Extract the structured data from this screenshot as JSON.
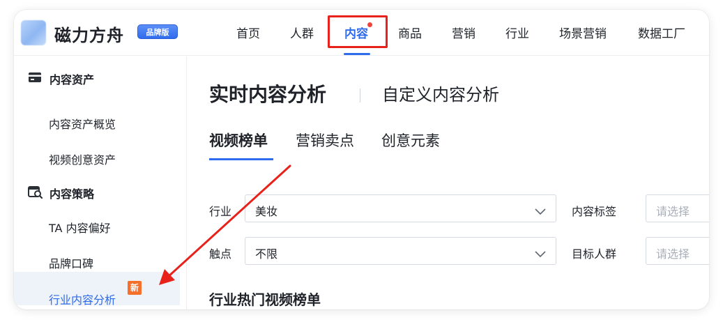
{
  "brand": {
    "name": "磁力方舟",
    "badge": "品牌版"
  },
  "nav": {
    "items": [
      {
        "label": "首页"
      },
      {
        "label": "人群"
      },
      {
        "label": "内容"
      },
      {
        "label": "商品"
      },
      {
        "label": "营销"
      },
      {
        "label": "行业"
      },
      {
        "label": "场景营销"
      },
      {
        "label": "数据工厂"
      }
    ],
    "active_index": 2
  },
  "sidebar": {
    "sections": [
      {
        "label": "内容资产",
        "items": [
          "内容资产概览",
          "视频创意资产"
        ]
      },
      {
        "label": "内容策略",
        "items": [
          "TA 内容偏好",
          "品牌口碑",
          "行业内容分析"
        ]
      }
    ],
    "active_item": "行业内容分析",
    "new_badge": "新"
  },
  "main": {
    "title": "实时内容分析",
    "title_alt": "自定义内容分析",
    "tabs": [
      "视频榜单",
      "营销卖点",
      "创意元素"
    ],
    "active_tab": 0,
    "filters": {
      "industry": {
        "label": "行业",
        "value": "美妆"
      },
      "content_tag": {
        "label": "内容标签",
        "placeholder": "请选择"
      },
      "touchpoint": {
        "label": "触点",
        "value": "不限"
      },
      "target_audience": {
        "label": "目标人群",
        "placeholder": "请选择"
      }
    },
    "section_title": "行业热门视频榜单"
  },
  "colors": {
    "accent": "#2f6bed",
    "annotation_red": "#e8211a",
    "new_badge": "#f5702b",
    "active_bg": "#eef2f9"
  }
}
